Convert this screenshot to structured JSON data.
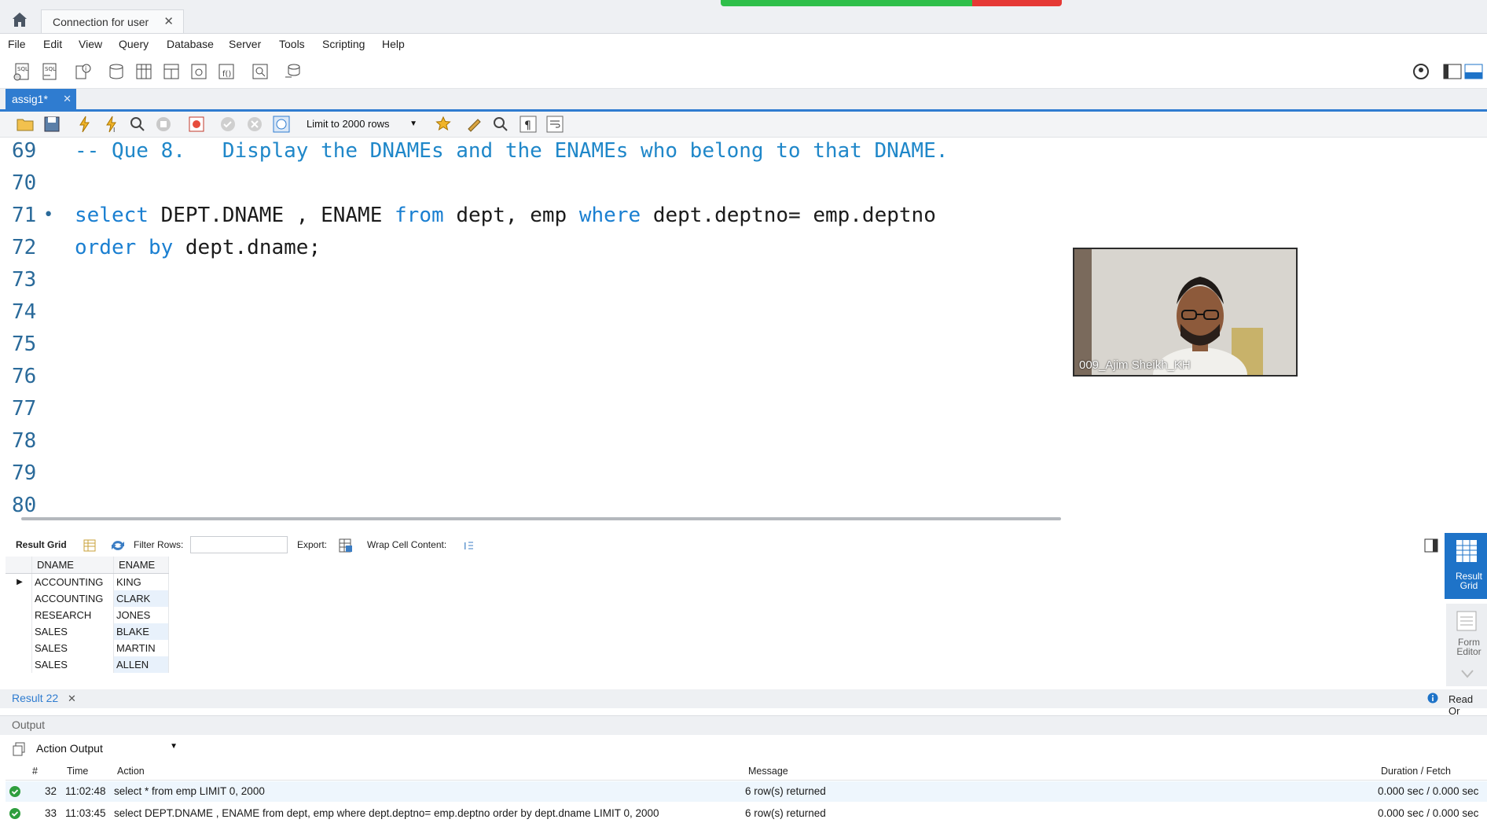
{
  "connection_tab": {
    "label": "Connection for user",
    "close": "✕"
  },
  "menu": [
    "File",
    "Edit",
    "View",
    "Query",
    "Database",
    "Server",
    "Tools",
    "Scripting",
    "Help"
  ],
  "editor_tab": {
    "label": "assig1*",
    "close": "✕"
  },
  "editor_toolbar": {
    "limit": "Limit to 2000 rows"
  },
  "editor": {
    "lines": [
      {
        "num": "69",
        "text": "-- Que 8.   Display the DNAMEs and the ENAMEs who belong to that DNAME."
      },
      {
        "num": "70",
        "text": ""
      },
      {
        "num": "71",
        "text": "select DEPT.DNAME , ENAME from dept, emp where dept.deptno= emp.deptno"
      },
      {
        "num": "72",
        "text": "order by dept.dname;"
      },
      {
        "num": "73",
        "text": ""
      },
      {
        "num": "74",
        "text": ""
      },
      {
        "num": "75",
        "text": ""
      },
      {
        "num": "76",
        "text": ""
      },
      {
        "num": "77",
        "text": ""
      },
      {
        "num": "78",
        "text": ""
      },
      {
        "num": "79",
        "text": ""
      },
      {
        "num": "80",
        "text": ""
      }
    ]
  },
  "webcam": {
    "name": "009_Ajim Sheikh_KH"
  },
  "result_toolbar": {
    "result_grid": "Result Grid",
    "filter_rows": "Filter Rows:",
    "export": "Export:",
    "wrap": "Wrap Cell Content:"
  },
  "result_grid": {
    "columns": [
      "DNAME",
      "ENAME"
    ],
    "rows": [
      [
        "ACCOUNTING",
        "KING"
      ],
      [
        "ACCOUNTING",
        "CLARK"
      ],
      [
        "RESEARCH",
        "JONES"
      ],
      [
        "SALES",
        "BLAKE"
      ],
      [
        "SALES",
        "MARTIN"
      ],
      [
        "SALES",
        "ALLEN"
      ]
    ]
  },
  "side_panel": {
    "result_grid": "Result Grid",
    "form_editor": "Form Editor"
  },
  "result_tab": {
    "label": "Result 22",
    "close": "✕",
    "read_only": "Read Or"
  },
  "output": {
    "label": "Output",
    "select": "Action Output",
    "columns": [
      "#",
      "Time",
      "Action",
      "Message",
      "Duration / Fetch"
    ],
    "rows": [
      {
        "num": "32",
        "time": "11:02:48",
        "action": "select * from emp LIMIT 0, 2000",
        "message": "6 row(s) returned",
        "duration": "0.000 sec / 0.000 sec"
      },
      {
        "num": "33",
        "time": "11:03:45",
        "action": "select DEPT.DNAME , ENAME from dept, emp where dept.deptno= emp.deptno order by dept.dname LIMIT 0, 2000",
        "message": "6 row(s) returned",
        "duration": "0.000 sec / 0.000 sec"
      }
    ]
  },
  "colors": {
    "accent": "#2f7cd0",
    "keyword": "#1a7fd1",
    "ok": "#2e9e3e"
  }
}
